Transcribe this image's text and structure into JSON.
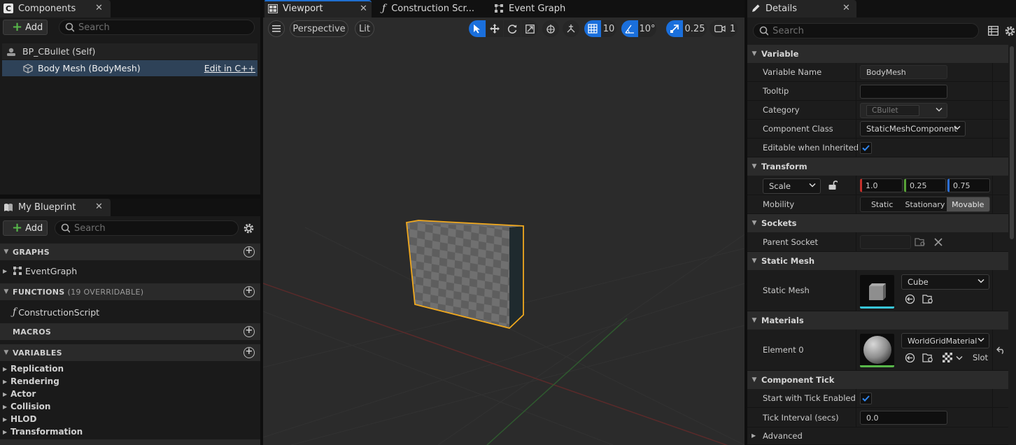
{
  "components_panel": {
    "tab_title": "Components",
    "add_label": "Add",
    "search_placeholder": "Search",
    "tree": [
      {
        "label": "BP_CBullet (Self)"
      },
      {
        "label": "Body Mesh (BodyMesh)",
        "action": "Edit in C++"
      }
    ]
  },
  "my_blueprint": {
    "tab_title": "My Blueprint",
    "add_label": "Add",
    "search_placeholder": "Search",
    "graphs_label": "GRAPHS",
    "graphs_items": [
      "EventGraph"
    ],
    "functions_label": "FUNCTIONS",
    "functions_count": "(19 OVERRIDABLE)",
    "functions_items": [
      "ConstructionScript"
    ],
    "macros_label": "MACROS",
    "variables_label": "VARIABLES",
    "variable_categories": [
      "Replication",
      "Rendering",
      "Actor",
      "Collision",
      "HLOD",
      "Transformation"
    ]
  },
  "editor_tabs": [
    {
      "label": "Viewport",
      "active": true
    },
    {
      "label": "Construction Scr..."
    },
    {
      "label": "Event Graph"
    }
  ],
  "viewport_toolbar": {
    "view_mode": "Perspective",
    "lighting": "Lit",
    "grid_snap": "10",
    "rotation_snap": "10°",
    "scale_snap": "0.25",
    "camera_speed": "1"
  },
  "details": {
    "tab_title": "Details",
    "search_placeholder": "Search",
    "variable": {
      "header": "Variable",
      "name_label": "Variable Name",
      "name_value": "BodyMesh",
      "tooltip_label": "Tooltip",
      "tooltip_value": "",
      "category_label": "Category",
      "category_value": "CBullet",
      "class_label": "Component Class",
      "class_value": "StaticMeshComponent",
      "editable_label": "Editable when Inherited",
      "editable_checked": true
    },
    "transform": {
      "header": "Transform",
      "scale_mode": "Scale",
      "scale_x": "1.0",
      "scale_y": "0.25",
      "scale_z": "0.75",
      "mobility_label": "Mobility",
      "mobility_options": [
        "Static",
        "Stationary",
        "Movable"
      ],
      "mobility_selected": "Movable"
    },
    "sockets": {
      "header": "Sockets",
      "parent_label": "Parent Socket",
      "parent_value": ""
    },
    "static_mesh": {
      "header": "Static Mesh",
      "label": "Static Mesh",
      "value": "Cube"
    },
    "materials": {
      "header": "Materials",
      "element_label": "Element 0",
      "value": "WorldGridMaterial",
      "slot_label": "Slot"
    },
    "component_tick": {
      "header": "Component Tick",
      "start_label": "Start with Tick Enabled",
      "start_checked": true,
      "interval_label": "Tick Interval (secs)",
      "interval_value": "0.0",
      "advanced_label": "Advanced"
    }
  },
  "colors": {
    "accent_blue": "#1a6fdc",
    "selection_outline": "#f0a81e",
    "add_green": "#57b84a"
  }
}
